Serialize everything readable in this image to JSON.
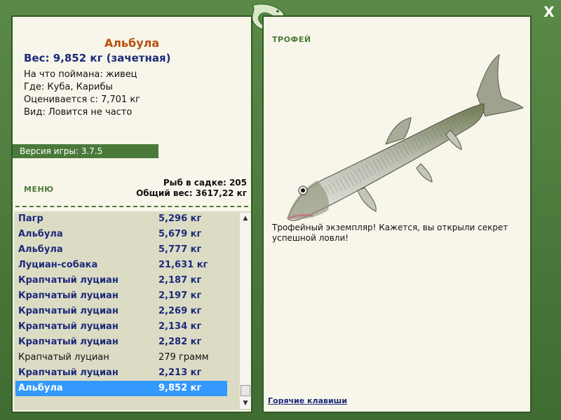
{
  "close_label": "X",
  "fish": {
    "name": "Альбула",
    "weight": "Вес: 9,852 кг (зачетная)",
    "info": [
      "На что поймана: живец",
      "Где: Куба, Карибы",
      "Оценивается с: 7,701 кг",
      "Вид: Ловится не часто"
    ]
  },
  "version": "Версия игры: 3.7.5",
  "menu_label": "МЕНЮ",
  "stats": {
    "count": "Рыб в садке: 205",
    "total": "Общий вес: 3617,22 кг"
  },
  "catch_list": [
    {
      "name": "Пагр",
      "weight": "5,296 кг"
    },
    {
      "name": "Альбула",
      "weight": "5,679 кг"
    },
    {
      "name": "Альбула",
      "weight": "5,777 кг"
    },
    {
      "name": "Луциан-собака",
      "weight": "21,631 кг"
    },
    {
      "name": "Крапчатый луциан",
      "weight": "2,187 кг"
    },
    {
      "name": "Крапчатый луциан",
      "weight": "2,197 кг"
    },
    {
      "name": "Крапчатый луциан",
      "weight": "2,269 кг"
    },
    {
      "name": "Крапчатый луциан",
      "weight": "2,134 кг"
    },
    {
      "name": "Крапчатый луциан",
      "weight": "2,282 кг"
    },
    {
      "name": "Крапчатый луциан",
      "weight": "279 грамм"
    },
    {
      "name": "Крапчатый луциан",
      "weight": "2,213 кг"
    },
    {
      "name": "Альбула",
      "weight": "9,852 кг"
    }
  ],
  "trophy_label": "ТРОФЕЙ",
  "trophy_text": "Трофейный экземпляр! Кажется, вы открыли секрет успешной ловли!",
  "hotkeys_label": "Горячие клавиши",
  "icons": {
    "logo": "lizard-logo-icon",
    "close": "close-icon",
    "scroll_up": "scroll-up-icon",
    "scroll_down": "scroll-down-icon"
  },
  "colors": {
    "frame": "#4a7a3a",
    "panel": "#f8f6ea",
    "title": "#b8500e",
    "link": "#1c2a7a",
    "selection": "#3399ff"
  }
}
